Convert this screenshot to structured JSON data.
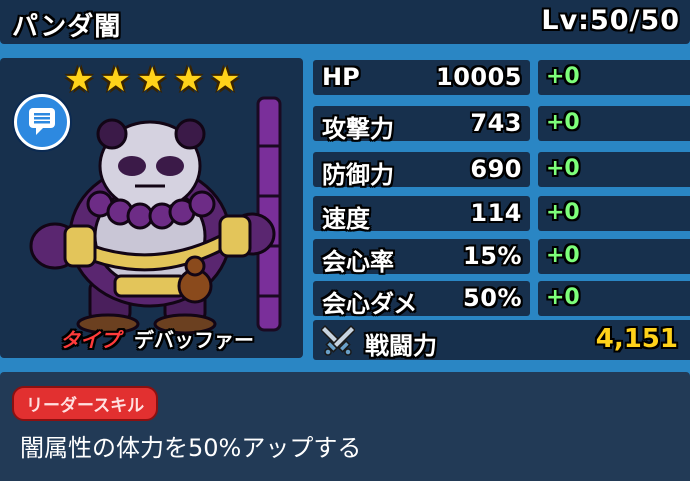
{
  "header": {
    "title": "パンダ闇",
    "level": "Lv:50/50"
  },
  "character": {
    "stars": 5,
    "type_label": "タイプ",
    "type_value": "デバッファー",
    "icons": {
      "chat": "chat-bubble-icon",
      "monster": "panda-monk-character"
    }
  },
  "stats": [
    {
      "name": "HP",
      "value": "10005",
      "bonus": "+0"
    },
    {
      "name": "攻撃力",
      "value": "743",
      "bonus": "+0"
    },
    {
      "name": "防御力",
      "value": "690",
      "bonus": "+0"
    },
    {
      "name": "速度",
      "value": "114",
      "bonus": "+0"
    },
    {
      "name": "会心率",
      "value": "15%",
      "bonus": "+0"
    },
    {
      "name": "会心ダメ",
      "value": "50%",
      "bonus": "+0"
    }
  ],
  "power": {
    "label": "戦闘力",
    "value": "4,151",
    "icon": "crossed-swords-icon"
  },
  "leader_skill": {
    "badge": "リーダースキル",
    "text": "闇属性の体力を50%アップする"
  },
  "colors": {
    "background": "#2a86c4",
    "panel": "#17304d",
    "bonus": "#7dff7a",
    "power": "#ffd21a",
    "type": "#ff3b3b",
    "badge": "#e23030"
  }
}
